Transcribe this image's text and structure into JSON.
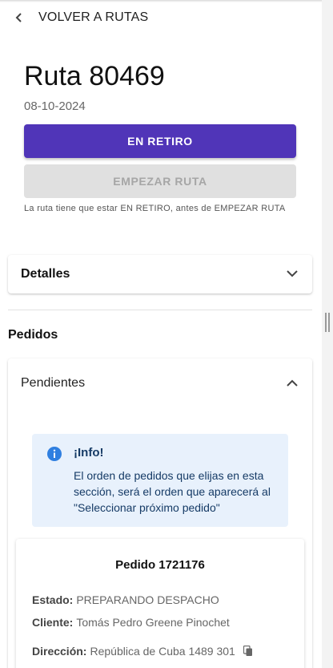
{
  "nav": {
    "back_label": "VOLVER A RUTAS"
  },
  "route": {
    "title": "Ruta 80469",
    "date": "08-10-2024"
  },
  "actions": {
    "primary_label": "EN RETIRO",
    "secondary_label": "EMPEZAR RUTA",
    "hint": "La ruta tiene que estar EN RETIRO, antes de EMPEZAR RUTA"
  },
  "details": {
    "title": "Detalles"
  },
  "orders": {
    "section_title": "Pedidos",
    "pending_title": "Pendientes",
    "info": {
      "title": "¡Info!",
      "text": "El orden de pedidos que elijas en esta sección, será el orden que aparecerá al \"Seleccionar próximo pedido\""
    },
    "first": {
      "title": "Pedido 1721176",
      "estado_label": "Estado:",
      "estado_value": "PREPARANDO DESPACHO",
      "cliente_label": "Cliente:",
      "cliente_value": "Tomás Pedro Greene Pinochet",
      "direccion_label": "Dirección:",
      "direccion_value": "República de Cuba 1489 301"
    }
  },
  "colors": {
    "primary": "#5035b8",
    "disabled": "#e0e0e0",
    "info_bg": "#e8f1fc",
    "info_icon": "#2f7fe0"
  }
}
